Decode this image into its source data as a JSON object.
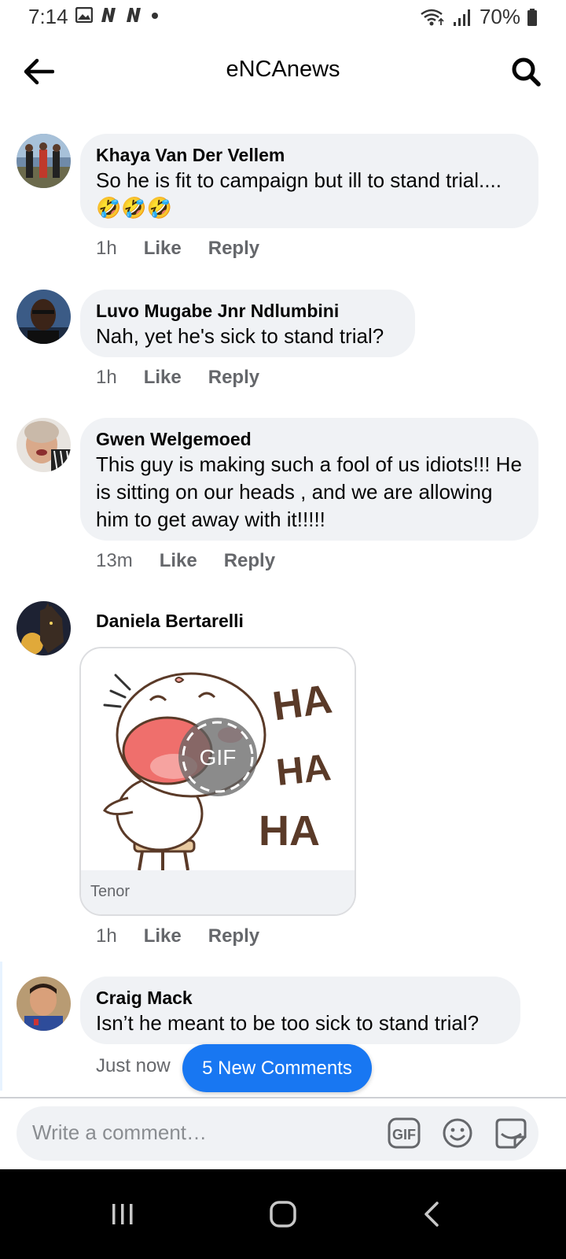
{
  "status_bar": {
    "time": "7:14",
    "battery": "70%",
    "icons": [
      "image-icon",
      "netflix-n-icon",
      "netflix-n-icon",
      "dot-icon",
      "wifi-icon",
      "signal-icon",
      "battery-icon"
    ]
  },
  "header": {
    "title": "eNCAnews",
    "back_icon": "arrow-left-icon",
    "search_icon": "search-icon"
  },
  "actions": {
    "like": "Like",
    "reply": "Reply"
  },
  "comments": [
    {
      "author": "Khaya Van Der Vellem",
      "text": "So he is fit to campaign but ill to stand trial....🤣🤣🤣",
      "time": "1h"
    },
    {
      "author": "Luvo Mugabe Jnr Ndlumbini",
      "text": "Nah, yet he's sick to stand trial?",
      "time": "1h"
    },
    {
      "author": "Gwen Welgemoed",
      "text": "This guy is making such a fool of us idiots!!! He is sitting on our heads , and we are allowing him to get away with it!!!!!",
      "time": "13m"
    },
    {
      "author": "Daniela Bertarelli",
      "gif_source": "Tenor",
      "gif_badge": "GIF",
      "gif_text": [
        "HA",
        "HA",
        "HA"
      ],
      "time": "1h"
    },
    {
      "author": "Craig Mack",
      "text": "Isn’t he meant to be too sick to stand trial?",
      "time": "Just now"
    }
  ],
  "new_comments_label": "5 New Comments",
  "composer": {
    "placeholder": "Write a comment…",
    "icons": [
      "gif-icon",
      "emoji-icon",
      "sticker-icon"
    ]
  },
  "colors": {
    "accent": "#1877f2",
    "bubble": "#f0f2f5",
    "secondary_text": "#65676b"
  }
}
